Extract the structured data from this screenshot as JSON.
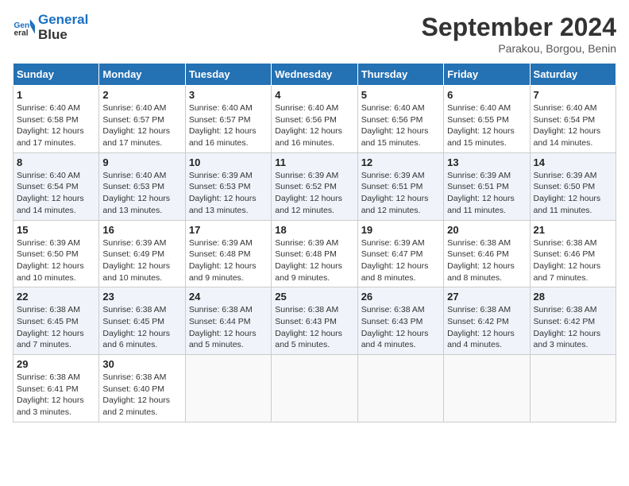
{
  "header": {
    "logo_line1": "General",
    "logo_line2": "Blue",
    "month": "September 2024",
    "location": "Parakou, Borgou, Benin"
  },
  "weekdays": [
    "Sunday",
    "Monday",
    "Tuesday",
    "Wednesday",
    "Thursday",
    "Friday",
    "Saturday"
  ],
  "weeks": [
    [
      {
        "day": "1",
        "sunrise": "6:40 AM",
        "sunset": "6:58 PM",
        "daylight": "12 hours and 17 minutes."
      },
      {
        "day": "2",
        "sunrise": "6:40 AM",
        "sunset": "6:57 PM",
        "daylight": "12 hours and 17 minutes."
      },
      {
        "day": "3",
        "sunrise": "6:40 AM",
        "sunset": "6:57 PM",
        "daylight": "12 hours and 16 minutes."
      },
      {
        "day": "4",
        "sunrise": "6:40 AM",
        "sunset": "6:56 PM",
        "daylight": "12 hours and 16 minutes."
      },
      {
        "day": "5",
        "sunrise": "6:40 AM",
        "sunset": "6:56 PM",
        "daylight": "12 hours and 15 minutes."
      },
      {
        "day": "6",
        "sunrise": "6:40 AM",
        "sunset": "6:55 PM",
        "daylight": "12 hours and 15 minutes."
      },
      {
        "day": "7",
        "sunrise": "6:40 AM",
        "sunset": "6:54 PM",
        "daylight": "12 hours and 14 minutes."
      }
    ],
    [
      {
        "day": "8",
        "sunrise": "6:40 AM",
        "sunset": "6:54 PM",
        "daylight": "12 hours and 14 minutes."
      },
      {
        "day": "9",
        "sunrise": "6:40 AM",
        "sunset": "6:53 PM",
        "daylight": "12 hours and 13 minutes."
      },
      {
        "day": "10",
        "sunrise": "6:39 AM",
        "sunset": "6:53 PM",
        "daylight": "12 hours and 13 minutes."
      },
      {
        "day": "11",
        "sunrise": "6:39 AM",
        "sunset": "6:52 PM",
        "daylight": "12 hours and 12 minutes."
      },
      {
        "day": "12",
        "sunrise": "6:39 AM",
        "sunset": "6:51 PM",
        "daylight": "12 hours and 12 minutes."
      },
      {
        "day": "13",
        "sunrise": "6:39 AM",
        "sunset": "6:51 PM",
        "daylight": "12 hours and 11 minutes."
      },
      {
        "day": "14",
        "sunrise": "6:39 AM",
        "sunset": "6:50 PM",
        "daylight": "12 hours and 11 minutes."
      }
    ],
    [
      {
        "day": "15",
        "sunrise": "6:39 AM",
        "sunset": "6:50 PM",
        "daylight": "12 hours and 10 minutes."
      },
      {
        "day": "16",
        "sunrise": "6:39 AM",
        "sunset": "6:49 PM",
        "daylight": "12 hours and 10 minutes."
      },
      {
        "day": "17",
        "sunrise": "6:39 AM",
        "sunset": "6:48 PM",
        "daylight": "12 hours and 9 minutes."
      },
      {
        "day": "18",
        "sunrise": "6:39 AM",
        "sunset": "6:48 PM",
        "daylight": "12 hours and 9 minutes."
      },
      {
        "day": "19",
        "sunrise": "6:39 AM",
        "sunset": "6:47 PM",
        "daylight": "12 hours and 8 minutes."
      },
      {
        "day": "20",
        "sunrise": "6:38 AM",
        "sunset": "6:46 PM",
        "daylight": "12 hours and 8 minutes."
      },
      {
        "day": "21",
        "sunrise": "6:38 AM",
        "sunset": "6:46 PM",
        "daylight": "12 hours and 7 minutes."
      }
    ],
    [
      {
        "day": "22",
        "sunrise": "6:38 AM",
        "sunset": "6:45 PM",
        "daylight": "12 hours and 7 minutes."
      },
      {
        "day": "23",
        "sunrise": "6:38 AM",
        "sunset": "6:45 PM",
        "daylight": "12 hours and 6 minutes."
      },
      {
        "day": "24",
        "sunrise": "6:38 AM",
        "sunset": "6:44 PM",
        "daylight": "12 hours and 5 minutes."
      },
      {
        "day": "25",
        "sunrise": "6:38 AM",
        "sunset": "6:43 PM",
        "daylight": "12 hours and 5 minutes."
      },
      {
        "day": "26",
        "sunrise": "6:38 AM",
        "sunset": "6:43 PM",
        "daylight": "12 hours and 4 minutes."
      },
      {
        "day": "27",
        "sunrise": "6:38 AM",
        "sunset": "6:42 PM",
        "daylight": "12 hours and 4 minutes."
      },
      {
        "day": "28",
        "sunrise": "6:38 AM",
        "sunset": "6:42 PM",
        "daylight": "12 hours and 3 minutes."
      }
    ],
    [
      {
        "day": "29",
        "sunrise": "6:38 AM",
        "sunset": "6:41 PM",
        "daylight": "12 hours and 3 minutes."
      },
      {
        "day": "30",
        "sunrise": "6:38 AM",
        "sunset": "6:40 PM",
        "daylight": "12 hours and 2 minutes."
      },
      null,
      null,
      null,
      null,
      null
    ]
  ]
}
